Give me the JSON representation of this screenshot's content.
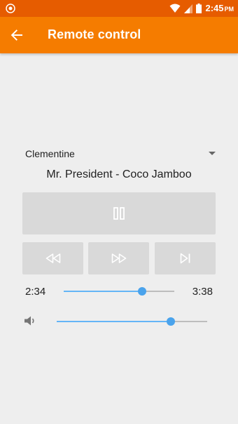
{
  "status_bar": {
    "time": "2:45",
    "ampm": "PM"
  },
  "app_bar": {
    "title": "Remote control",
    "back_icon": "arrow-back-icon"
  },
  "device": {
    "selected": "Clementine"
  },
  "track": {
    "title": "Mr. President - Coco Jamboo"
  },
  "controls": {
    "pause_icon": "pause-icon",
    "rewind_icon": "rewind-icon",
    "forward_icon": "fast-forward-icon",
    "next_icon": "skip-next-icon"
  },
  "progress": {
    "elapsed": "2:34",
    "total": "3:38",
    "fraction": 0.706
  },
  "volume": {
    "fraction": 0.76,
    "icon": "volume-icon"
  },
  "colors": {
    "status_bar": "#e65c00",
    "app_bar": "#f57c00",
    "accent": "#4aa3ec",
    "button": "#d9d9d9",
    "background": "#eeeeee"
  }
}
